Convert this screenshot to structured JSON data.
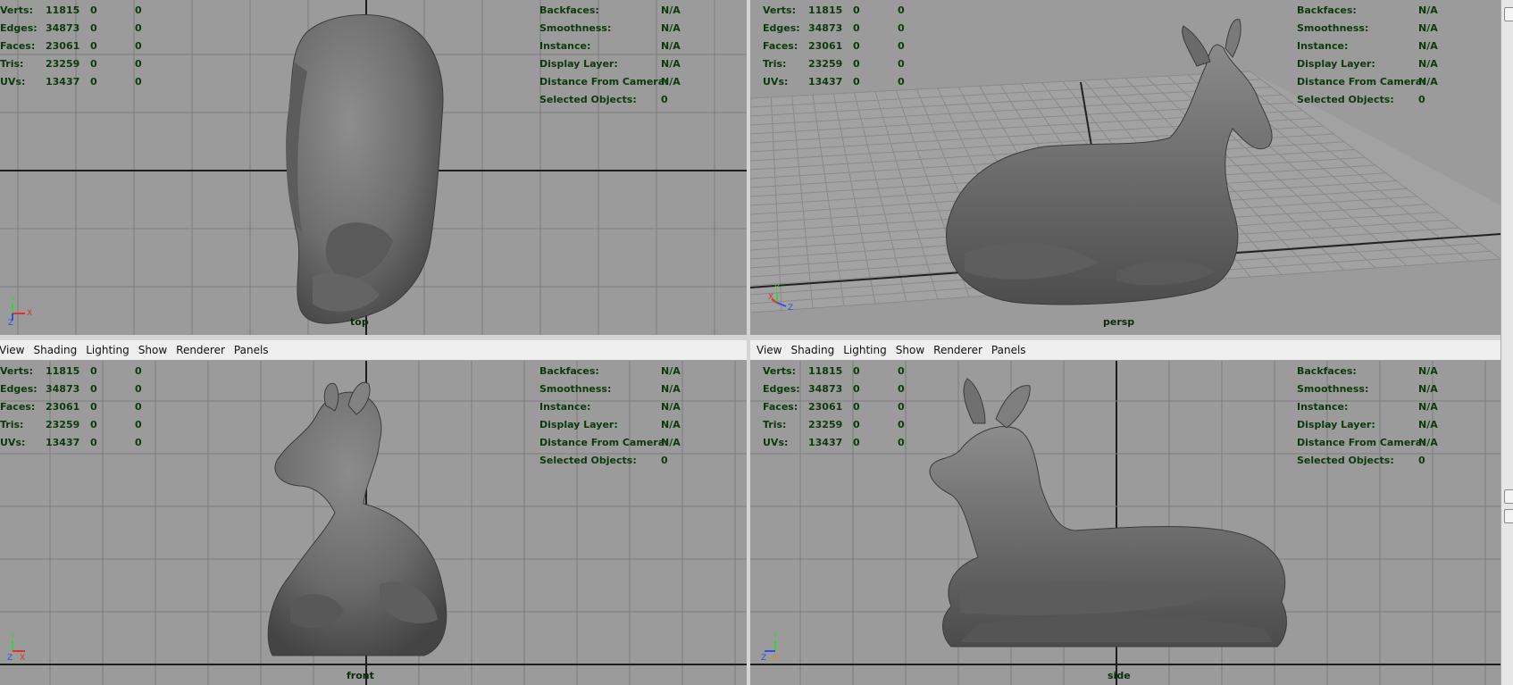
{
  "menu": [
    "View",
    "Shading",
    "Lighting",
    "Show",
    "Renderer",
    "Panels"
  ],
  "hud_stats": [
    {
      "label": "Verts:",
      "v1": "11815",
      "v2": "0",
      "v3": "0"
    },
    {
      "label": "Edges:",
      "v1": "34873",
      "v2": "0",
      "v3": "0"
    },
    {
      "label": "Faces:",
      "v1": "23061",
      "v2": "0",
      "v3": "0"
    },
    {
      "label": "Tris:",
      "v1": "23259",
      "v2": "0",
      "v3": "0"
    },
    {
      "label": "UVs:",
      "v1": "13437",
      "v2": "0",
      "v3": "0"
    }
  ],
  "hud_info": [
    {
      "label": "Backfaces:",
      "value": "N/A"
    },
    {
      "label": "Smoothness:",
      "value": "N/A"
    },
    {
      "label": "Instance:",
      "value": "N/A"
    },
    {
      "label": "Display Layer:",
      "value": "N/A"
    },
    {
      "label": "Distance From Camera:",
      "value": "N/A"
    },
    {
      "label": "Selected Objects:",
      "value": "0"
    }
  ],
  "viewports": {
    "top": {
      "camera": "top",
      "axes": [
        "Y",
        "X",
        "Z"
      ]
    },
    "persp": {
      "camera": "persp",
      "axes": [
        "Y",
        "X",
        "Z"
      ]
    },
    "front": {
      "camera": "front",
      "axes": [
        "Y",
        "Z",
        "X"
      ]
    },
    "side": {
      "camera": "side",
      "axes": [
        "Y",
        "Z",
        "X"
      ]
    }
  },
  "colors": {
    "viewport_bg": "#9b9b9b",
    "grid_line": "#7d7d7d",
    "axis_line": "#1e1e1e",
    "hud_text": "#0c3a0c",
    "menu_bg": "#efefef",
    "active_border": "#7f9db9"
  }
}
